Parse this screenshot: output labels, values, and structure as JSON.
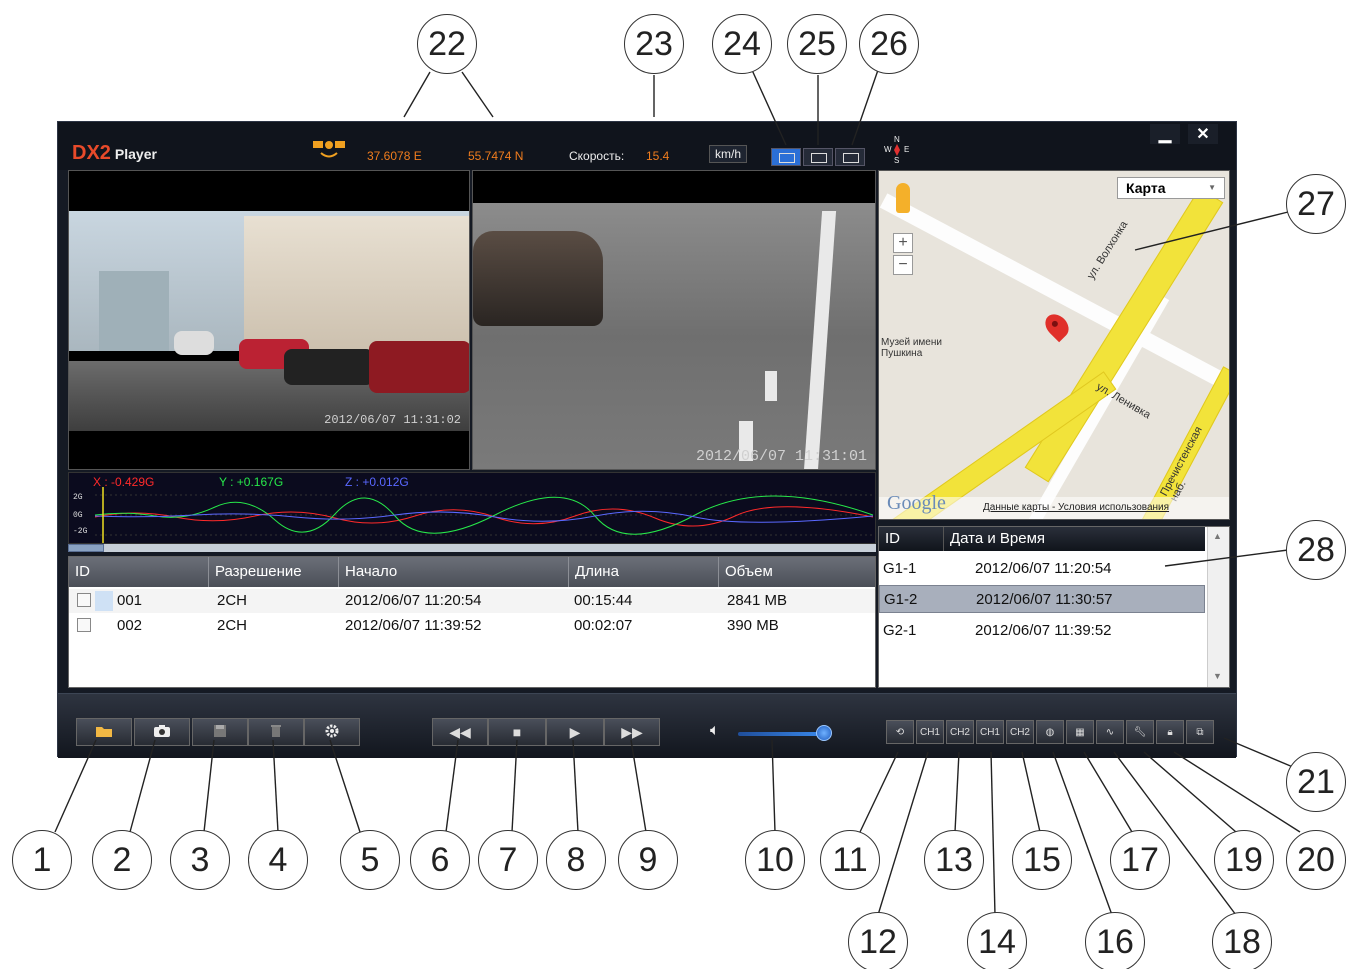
{
  "titlebar": {
    "brand": "DX2",
    "product": "Player",
    "longitude": "37.6078 E",
    "latitude": "55.7474 N",
    "speed_label": "Скорость:",
    "speed_value": "15.4",
    "speed_unit": "km/h",
    "compass": "N W E S",
    "minimize": "▁",
    "close": "✕"
  },
  "videos": [
    {
      "timestamp": "2012/06/07  11:31:02"
    },
    {
      "timestamp": "2012/06/07  11:31:01"
    }
  ],
  "map": {
    "type_select": "Карта",
    "zoom_in": "+",
    "zoom_out": "−",
    "labels": {
      "street1": "ул. Волхонка",
      "street2": "ул. Ленивка",
      "museum": "Музей имени Пушкина",
      "embankment": "Пречистенская наб."
    },
    "footer_logo": "Google",
    "footer_links": "Данные карты - Условия использования"
  },
  "accelerometer": {
    "x": "X : -0.429G",
    "y": "Y : +0.167G",
    "z": "Z : +0.012G",
    "scale_top": "2G",
    "scale_mid": "0G",
    "scale_bottom": "-2G",
    "colors": {
      "x": "#ff2a2a",
      "y": "#27e84a",
      "z": "#5a68ff"
    }
  },
  "files": {
    "headers": [
      "ID",
      "Разрешение",
      "Начало",
      "Длина",
      "Объем"
    ],
    "rows": [
      {
        "id": "001",
        "res": "2CH",
        "start": "2012/06/07 11:20:54",
        "length": "00:15:44",
        "size": "2841 MB"
      },
      {
        "id": "002",
        "res": "2CH",
        "start": "2012/06/07 11:39:52",
        "length": "00:02:07",
        "size": "390 MB"
      }
    ]
  },
  "events": {
    "headers": [
      "ID",
      "Дата и Время"
    ],
    "rows": [
      {
        "id": "G1-1",
        "time": "2012/06/07  11:20:54"
      },
      {
        "id": "G1-2",
        "time": "2012/06/07  11:30:57"
      },
      {
        "id": "G2-1",
        "time": "2012/06/07  11:39:52"
      }
    ],
    "selected_index": 1
  },
  "volume": {
    "level": 0.85
  },
  "callouts": [
    "1",
    "2",
    "3",
    "4",
    "5",
    "6",
    "7",
    "8",
    "9",
    "10",
    "11",
    "12",
    "13",
    "14",
    "15",
    "16",
    "17",
    "18",
    "19",
    "20",
    "21",
    "22",
    "23",
    "24",
    "25",
    "26",
    "27",
    "28"
  ],
  "toolbar": {
    "side_buttons": [
      "CH1",
      "CH2",
      "CH1",
      "CH2"
    ]
  }
}
